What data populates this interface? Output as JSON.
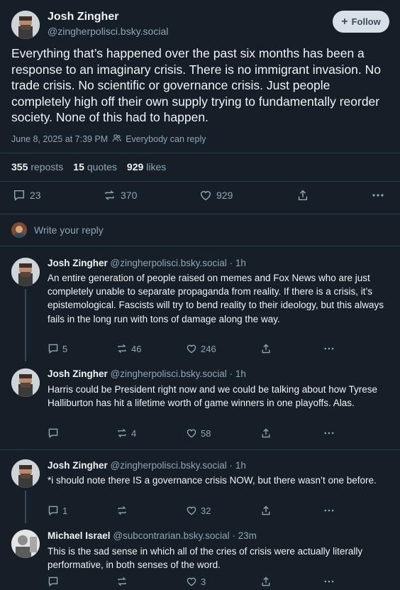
{
  "main_post": {
    "author_name": "Josh Zingher",
    "author_handle": "@zingherpolisci.bsky.social",
    "follow_label": "Follow",
    "text": "Everything that’s happened over the past six months has been a response to an imaginary crisis. There is no immigrant invasion. No trade crisis. No scientific or governance crisis. Just people completely high off their own supply trying to fundamentally reorder society. None of this had to happen.",
    "timestamp": "June 8, 2025 at 7:39 PM",
    "reply_setting": "Everybody can reply",
    "stats": {
      "reposts_count": "355",
      "reposts_label": "reposts",
      "quotes_count": "15",
      "quotes_label": "quotes",
      "likes_count": "929",
      "likes_label": "likes"
    },
    "actions": {
      "replies": "23",
      "reposts": "370",
      "likes": "929"
    }
  },
  "reply_composer": {
    "placeholder": "Write your reply"
  },
  "replies": [
    {
      "author_name": "Josh Zingher",
      "author_handle": "@zingherpolisci.bsky.social",
      "time": "· 1h",
      "text": "An entire generation of people raised on memes and Fox News who are just completely unable to separate propaganda from reality. If there is a crisis, it’s epistemological. Fascists will try to bend reality to their ideology, but this always fails in the long run with tons of damage along the way.",
      "replies": "5",
      "reposts": "46",
      "likes": "246"
    },
    {
      "author_name": "Josh Zingher",
      "author_handle": "@zingherpolisci.bsky.social",
      "time": "· 1h",
      "text": "Harris could be President right now and we could be talking about how Tyrese Halliburton has hit a lifetime worth of game winners in one playoffs. Alas.",
      "replies": "",
      "reposts": "4",
      "likes": "58"
    },
    {
      "author_name": "Josh Zingher",
      "author_handle": "@zingherpolisci.bsky.social",
      "time": "· 1h",
      "text": "*i should note there IS a governance crisis NOW, but there wasn’t one before.",
      "replies": "1",
      "reposts": "",
      "likes": "32"
    },
    {
      "author_name": "Michael Israel",
      "author_handle": "@subcontrarian.bsky.social",
      "time": "· 23m",
      "text": "This is the sad sense in which all of the cries of crisis were actually literally performative, in both senses of the word.",
      "replies": "",
      "reposts": "",
      "likes": "3"
    }
  ],
  "colors": {
    "background": "#161e27",
    "muted": "#93a5b7",
    "follow_bg": "#d8dfe6",
    "divider": "#2e3a47"
  }
}
